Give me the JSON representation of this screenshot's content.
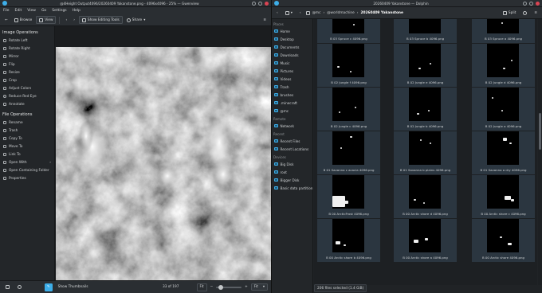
{
  "gwenview": {
    "title": "@4Height Output4096/20260409 Yakanstone.png - 4096x4096 - 25% — Gwenview",
    "menu": [
      "File",
      "Edit",
      "View",
      "Go",
      "Settings",
      "Help"
    ],
    "toolbar": {
      "browse": "Browse",
      "view": "View",
      "edit_tools": "Show Editing Tools",
      "share": "Share"
    },
    "image_ops_title": "Image Operations",
    "image_ops": [
      "Rotate Left",
      "Rotate Right",
      "Mirror",
      "Flip",
      "Resize",
      "Crop",
      "Adjust Colors",
      "Reduce Red Eye",
      "Annotate"
    ],
    "file_ops_title": "File Operations",
    "file_ops": [
      "Rename",
      "Trash",
      "Copy To",
      "Move To",
      "Link To",
      "Open With",
      "Open Containing Folder",
      "Properties"
    ],
    "status": {
      "thumbnails": "Show Thumbnails",
      "counter": "33 of 197",
      "fit": "Fit",
      "zoom_combo": "Fit"
    }
  },
  "dolphin": {
    "title": "20260409 Yakanstone — Dolphin",
    "breadcrumb": [
      "@mc",
      "@worldmachine",
      "20260409 Yakanstone"
    ],
    "split": "Split",
    "places_header": "Places",
    "places": [
      "Home",
      "Desktop",
      "Documents",
      "Downloads",
      "Music",
      "Pictures",
      "Videos",
      "Trash",
      "brushes",
      ".minecraft",
      "@mc"
    ],
    "remote_header": "Remote",
    "remote": [
      "Network"
    ],
    "recent_header": "Recent",
    "recent": [
      "Recent Files",
      "Recent Locations"
    ],
    "devices_header": "Devices",
    "devices": [
      "Big Disk",
      "root",
      "Bigger Disk",
      "Basic data partition"
    ],
    "files": [
      "B 03 Spruce c 4096.png",
      "B 03 Spruce b 4096.png",
      "B 03 Spruce a 4096.png",
      "B 02 Jungle f 4096.png",
      "B 02 Jungle e 4096.png",
      "B 02 Jungle d 4096.png",
      "B 02 Jungle c 4096.png",
      "B 02 Jungle b 4096.png",
      "B 02 Jungle a 4096.png",
      "B 01 Savanna c acacia 4096.png",
      "B 01 Savanna b plains 4096.png",
      "B 01 Savanna a dry 4096.png",
      "B 00 ArcticFrost 4096.png",
      "B 00 Arctic shore d 4096.png",
      "B 00 Arctic shore c 4096.png",
      "B 00 Arctic shore b 4096.png",
      "B 00 Arctic shore a 4096.png",
      "B 00 Arctic shore 4096.png"
    ],
    "status": "206 files selected (1.4 GiB)"
  }
}
